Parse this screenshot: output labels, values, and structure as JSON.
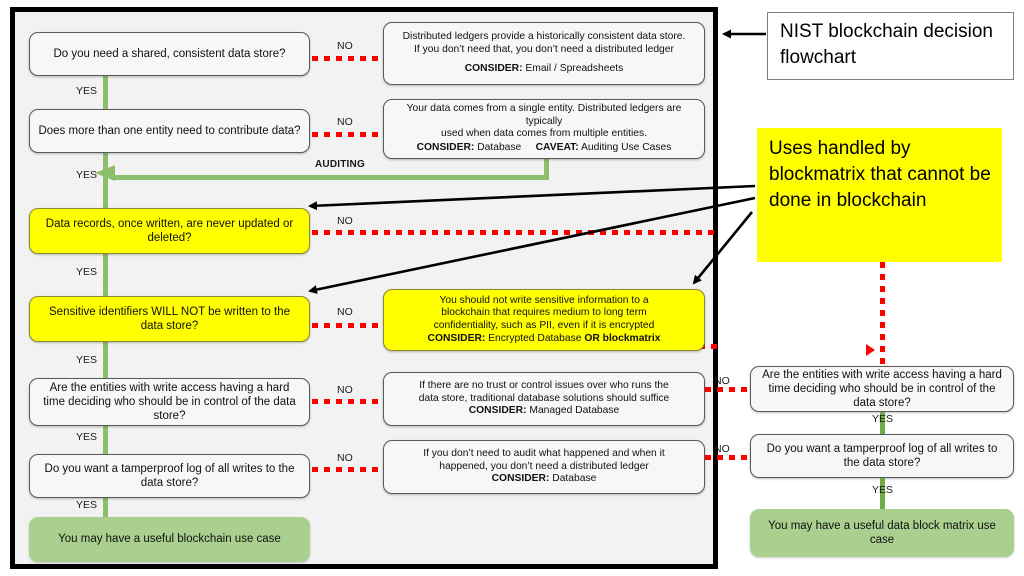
{
  "title_callouts": {
    "nist_title": "NIST blockchain decision flowchart",
    "blockmatrix_callout": "Uses handled by blockmatrix that cannot be done in blockchain"
  },
  "labels": {
    "yes": "YES",
    "no": "NO",
    "auditing": "AUDITING"
  },
  "colors": {
    "panel_background": "#f2f2f2",
    "panel_border": "#000000",
    "yes_connector": "#8cbf6b",
    "no_connector": "#ff0000",
    "highlight": "#ffff00",
    "terminal": "#a9d08e"
  },
  "left_flow": {
    "decisions": [
      {
        "id": "d1",
        "text": "Do you need a shared, consistent data store?",
        "highlight": false
      },
      {
        "id": "d2",
        "text": "Does more than one entity need to contribute data?",
        "highlight": false
      },
      {
        "id": "d3",
        "text": "Data records, once written, are never updated or deleted?",
        "highlight": true
      },
      {
        "id": "d4",
        "text": "Sensitive identifiers WILL NOT be written to the data store?",
        "highlight": true
      },
      {
        "id": "d5",
        "text": "Are the entities with write access having a hard time deciding who should be in control of the data store?",
        "highlight": false
      },
      {
        "id": "d6",
        "text": "Do you want a tamperproof log of all writes to the data store?",
        "highlight": false
      }
    ],
    "terminal": "You may have a useful blockchain use case",
    "info_boxes": [
      {
        "id": "i1",
        "highlight": false,
        "lines": [
          "Distributed ledgers provide a historically consistent data store.",
          "If you don’t need that, you don’t need a distributed ledger"
        ],
        "consider_label": "CONSIDER:",
        "consider_value": " Email / Spreadsheets",
        "caveat_label": "",
        "caveat_value": ""
      },
      {
        "id": "i2",
        "highlight": false,
        "lines": [
          "Your data comes from a single entity. Distributed ledgers are typically",
          "used when data comes from multiple entities."
        ],
        "consider_label": "CONSIDER:",
        "consider_value": " Database",
        "caveat_label": "CAVEAT:",
        "caveat_value": " Auditing Use Cases"
      },
      {
        "id": "i3",
        "highlight": true,
        "lines": [
          "You should not write sensitive information to a",
          "blockchain that requires medium to long term",
          "confidentiality, such as PII, even if it is encrypted"
        ],
        "consider_label": "CONSIDER:",
        "consider_value": " Encrypted Database ",
        "consider_bold_tail": "OR blockmatrix",
        "caveat_label": "",
        "caveat_value": ""
      },
      {
        "id": "i4",
        "highlight": false,
        "lines": [
          "If there are no trust or control issues over who runs the",
          "data store, traditional database solutions should suffice"
        ],
        "consider_label": "CONSIDER:",
        "consider_value": " Managed Database",
        "caveat_label": "",
        "caveat_value": ""
      },
      {
        "id": "i5",
        "highlight": false,
        "lines": [
          "If you don’t need to audit what happened and when it",
          "happened, you don’t need a distributed ledger"
        ],
        "consider_label": "CONSIDER:",
        "consider_value": " Database",
        "caveat_label": "",
        "caveat_value": ""
      }
    ]
  },
  "right_flow": {
    "decisions": [
      {
        "id": "r1",
        "text": "Are the entities with write access having a hard time deciding who should be in control of the data store?"
      },
      {
        "id": "r2",
        "text": "Do you want a tamperproof log of all writes to the data store?"
      }
    ],
    "terminal": "You may have a useful data block matrix use case"
  }
}
